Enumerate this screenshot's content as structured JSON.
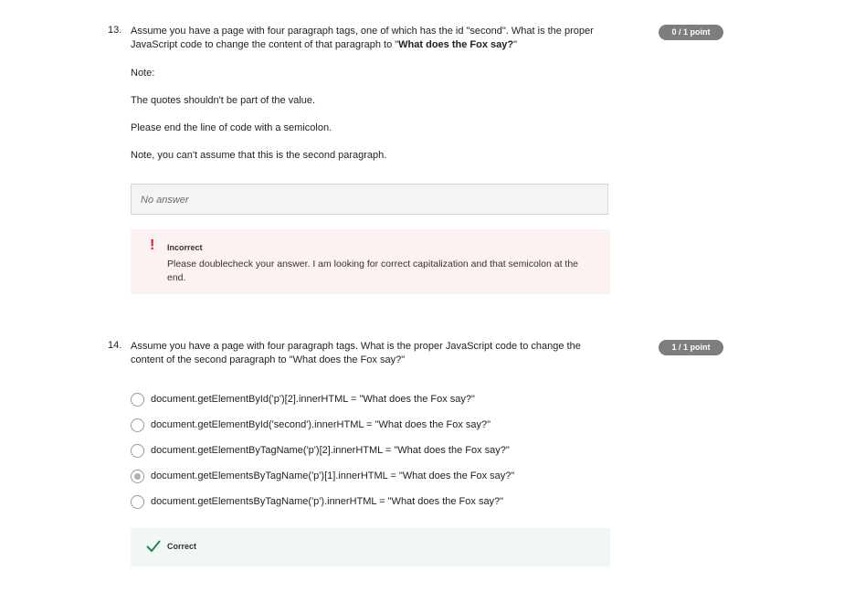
{
  "q13": {
    "number": "13.",
    "points": "0 / 1 point",
    "prompt_pre": "Assume you have a page with four paragraph tags, one of which has the id \"second\". What is the proper JavaScript code to change the content of that paragraph to \"",
    "prompt_bold": "What does the Fox say?",
    "prompt_post": "\"",
    "notes": [
      "Note:",
      "The quotes shouldn't be part of the value.",
      "Please end the line of code with a semicolon.",
      "Note, you can't assume that this is the second paragraph."
    ],
    "answer": "No answer",
    "feedback_title": "Incorrect",
    "feedback_text": "Please doublecheck your answer. I am looking for correct capitalization and that semicolon at the end."
  },
  "q14": {
    "number": "14.",
    "points": "1 / 1 point",
    "prompt": "Assume you have a page with four paragraph tags. What is the proper JavaScript code to change the content of the second paragraph to \"What does the Fox say?\"",
    "options": [
      {
        "label": "document.getElementById('p')[2].innerHTML = \"What does the Fox say?\"",
        "selected": false
      },
      {
        "label": "document.getElementById('second').innerHTML = \"What does the Fox say?\"",
        "selected": false
      },
      {
        "label": "document.getElementByTagName('p')[2].innerHTML = \"What does the Fox say?\"",
        "selected": false
      },
      {
        "label": "document.getElementsByTagName('p')[1].innerHTML = \"What does the Fox say?\"",
        "selected": true
      },
      {
        "label": "document.getElementsByTagName('p').innerHTML = \"What does the Fox say?\"",
        "selected": false
      }
    ],
    "feedback_title": "Correct"
  },
  "colors": {
    "incorrect_accent": "#d4202a",
    "incorrect_bg": "#fdf2f2",
    "correct_accent": "#1f8354",
    "correct_bg": "#f1f8f4",
    "points_badge": "#7d7d7d"
  },
  "icons": {
    "incorrect": "exclamation-icon",
    "correct": "checkmark-icon"
  }
}
